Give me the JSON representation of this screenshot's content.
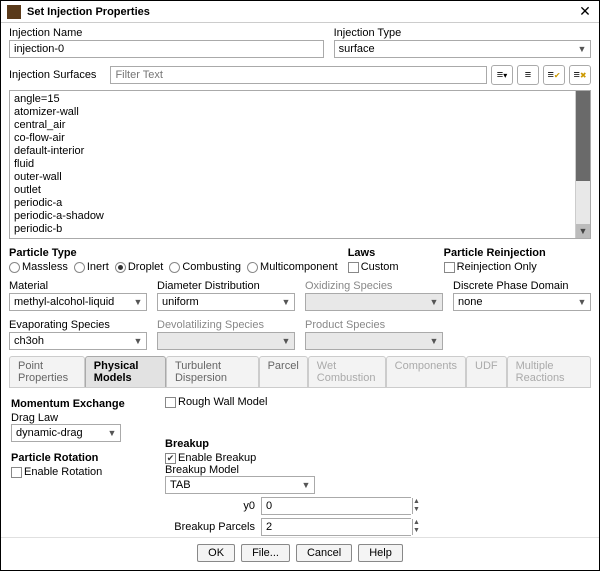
{
  "window": {
    "title": "Set Injection Properties"
  },
  "name": {
    "label": "Injection Name",
    "value": "injection-0"
  },
  "type": {
    "label": "Injection Type",
    "value": "surface"
  },
  "surfaces": {
    "label": "Injection Surfaces",
    "filter_placeholder": "Filter Text",
    "items": [
      "angle=15",
      "atomizer-wall",
      "central_air",
      "co-flow-air",
      "default-interior",
      "fluid",
      "outer-wall",
      "outlet",
      "periodic-a",
      "periodic-a-shadow",
      "periodic-b"
    ]
  },
  "toolbar_icons": [
    "list-toggle",
    "select-all",
    "select-shown",
    "deselect"
  ],
  "particle_type": {
    "label": "Particle Type",
    "options": [
      "Massless",
      "Inert",
      "Droplet",
      "Combusting",
      "Multicomponent"
    ],
    "selected": "Droplet"
  },
  "laws": {
    "label": "Laws",
    "custom_label": "Custom",
    "custom": false
  },
  "reinjection": {
    "label": "Particle Reinjection",
    "only_label": "Reinjection Only",
    "only": false
  },
  "material": {
    "label": "Material",
    "value": "methyl-alcohol-liquid"
  },
  "diameter": {
    "label": "Diameter Distribution",
    "value": "uniform"
  },
  "oxidizing": {
    "label": "Oxidizing Species",
    "value": ""
  },
  "domain": {
    "label": "Discrete Phase Domain",
    "value": "none"
  },
  "evap": {
    "label": "Evaporating Species",
    "value": "ch3oh"
  },
  "devol": {
    "label": "Devolatilizing Species",
    "value": ""
  },
  "product": {
    "label": "Product Species",
    "value": ""
  },
  "tabs": [
    "Point Properties",
    "Physical Models",
    "Turbulent Dispersion",
    "Parcel",
    "Wet Combustion",
    "Components",
    "UDF",
    "Multiple Reactions"
  ],
  "active_tab": "Physical Models",
  "phys": {
    "momentum_label": "Momentum Exchange",
    "drag_law_label": "Drag Law",
    "drag_law_value": "dynamic-drag",
    "rotation_label": "Particle Rotation",
    "enable_rotation_label": "Enable Rotation",
    "enable_rotation": false,
    "rough_wall_label": "Rough Wall Model",
    "rough_wall": false,
    "breakup_label": "Breakup",
    "enable_breakup_label": "Enable Breakup",
    "enable_breakup": true,
    "breakup_model_label": "Breakup Model",
    "breakup_model_value": "TAB",
    "y0_label": "y0",
    "y0_value": "0",
    "parcels_label": "Breakup Parcels",
    "parcels_value": "2"
  },
  "buttons": {
    "ok": "OK",
    "file": "File...",
    "cancel": "Cancel",
    "help": "Help"
  }
}
